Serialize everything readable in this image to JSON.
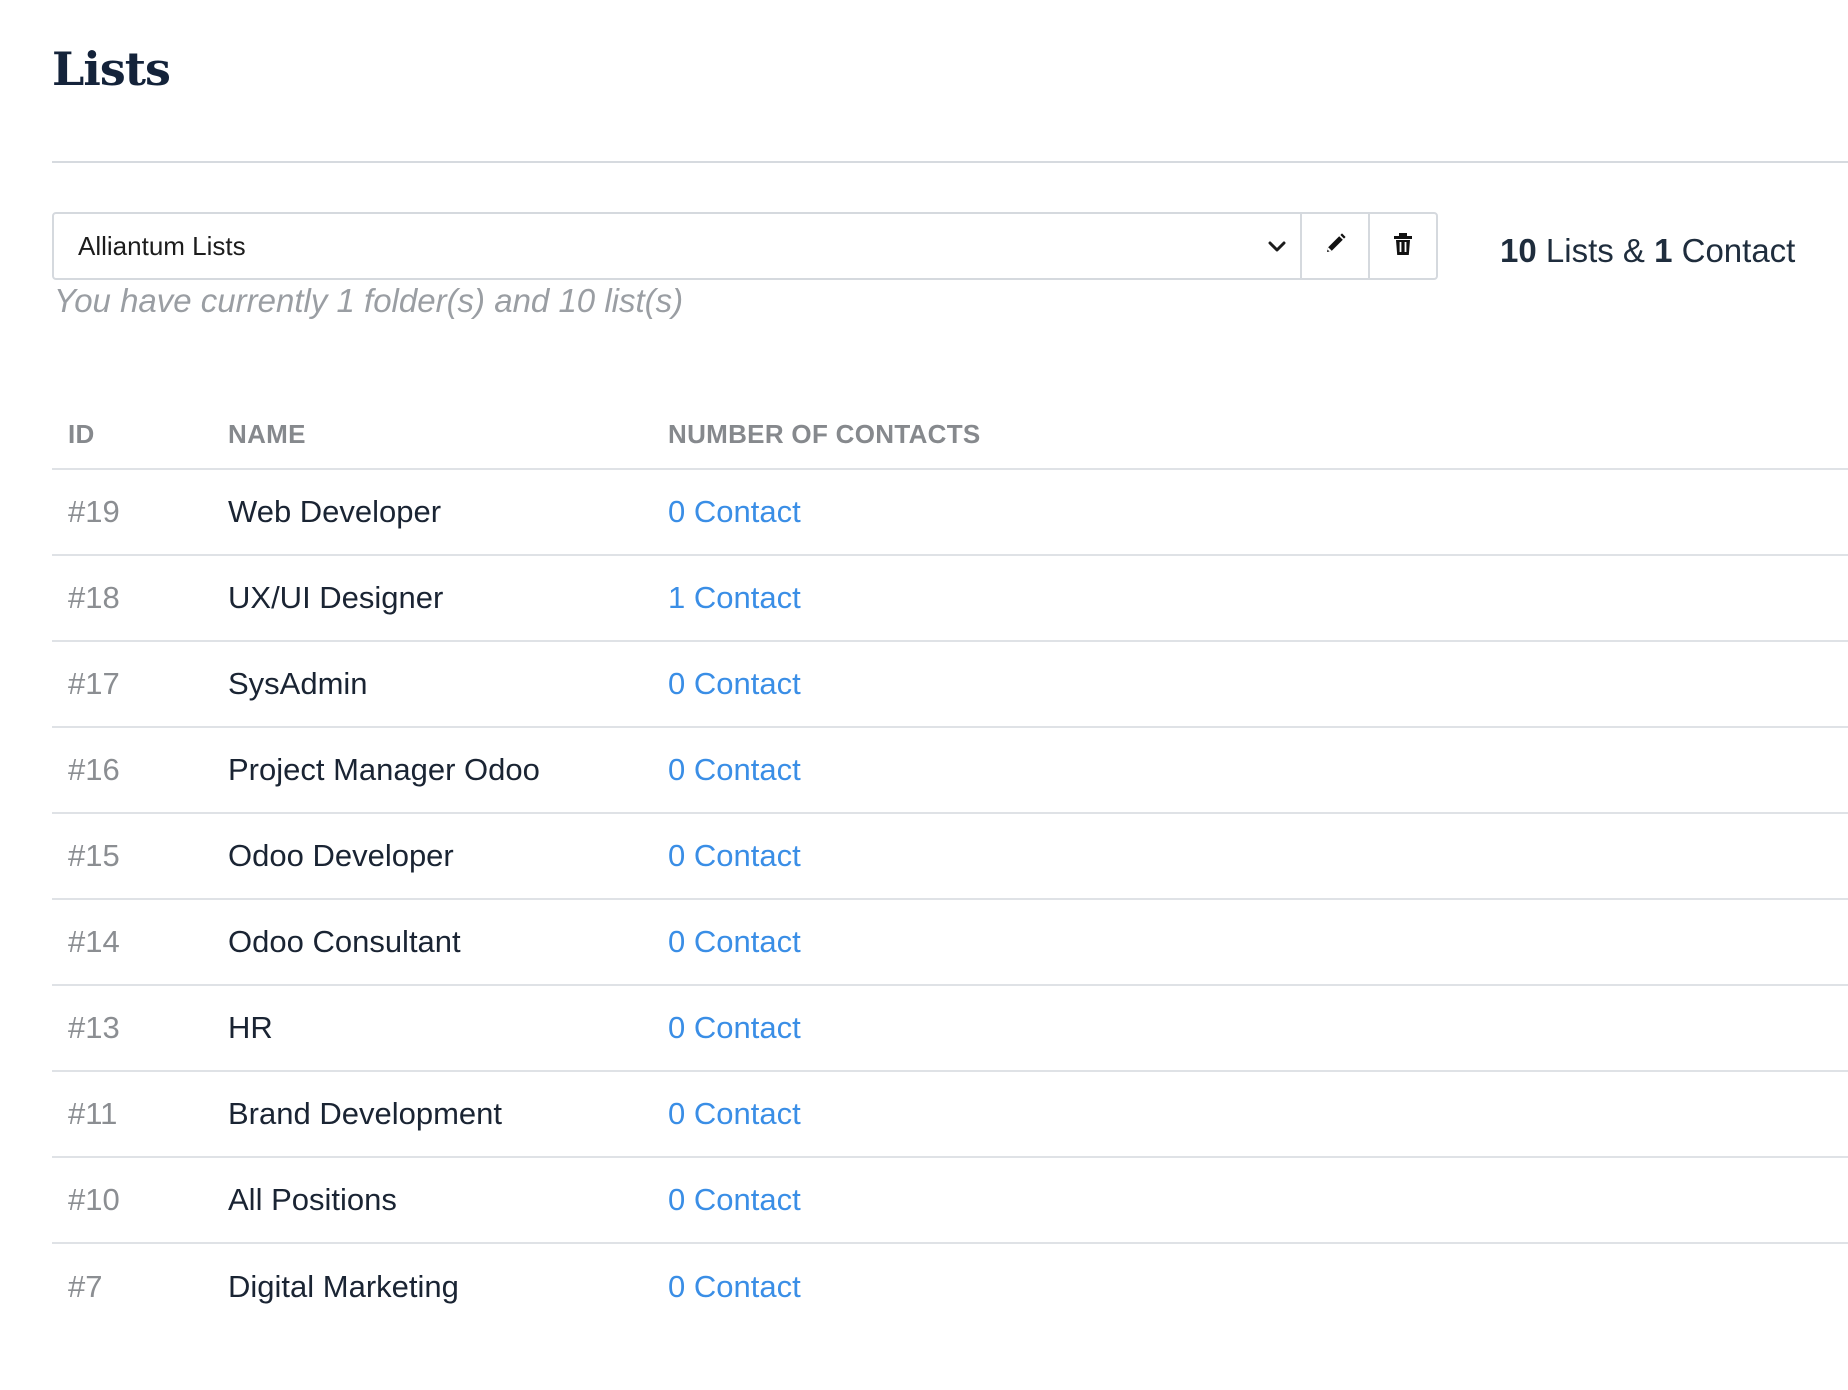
{
  "page": {
    "title": "Lists"
  },
  "folder": {
    "selected": "Alliantum Lists",
    "help_text": "You have currently 1 folder(s) and 10 list(s)",
    "edit_icon": "pencil-icon",
    "delete_icon": "trash-icon",
    "dropdown_icon": "chevron-down-icon"
  },
  "summary": {
    "lists_count": "10",
    "lists_label": " Lists & ",
    "contacts_count": "1",
    "contacts_label": " Contact"
  },
  "table": {
    "headers": {
      "id": "ID",
      "name": "NAME",
      "contacts": "NUMBER OF CONTACTS"
    },
    "rows": [
      {
        "id": "#19",
        "name": "Web Developer",
        "contacts": "0 Contact"
      },
      {
        "id": "#18",
        "name": "UX/UI Designer",
        "contacts": "1 Contact"
      },
      {
        "id": "#17",
        "name": "SysAdmin",
        "contacts": "0 Contact"
      },
      {
        "id": "#16",
        "name": "Project Manager Odoo",
        "contacts": "0 Contact"
      },
      {
        "id": "#15",
        "name": "Odoo Developer",
        "contacts": "0 Contact"
      },
      {
        "id": "#14",
        "name": "Odoo Consultant",
        "contacts": "0 Contact"
      },
      {
        "id": "#13",
        "name": "HR",
        "contacts": "0 Contact"
      },
      {
        "id": "#11",
        "name": "Brand Development",
        "contacts": "0 Contact"
      },
      {
        "id": "#10",
        "name": "All Positions",
        "contacts": "0 Contact"
      },
      {
        "id": "#7",
        "name": "Digital Marketing",
        "contacts": "0 Contact"
      }
    ]
  },
  "colors": {
    "link": "#3a8ee6",
    "title": "#14233a",
    "muted": "#8b8e92",
    "divider": "#dfe2e6"
  }
}
